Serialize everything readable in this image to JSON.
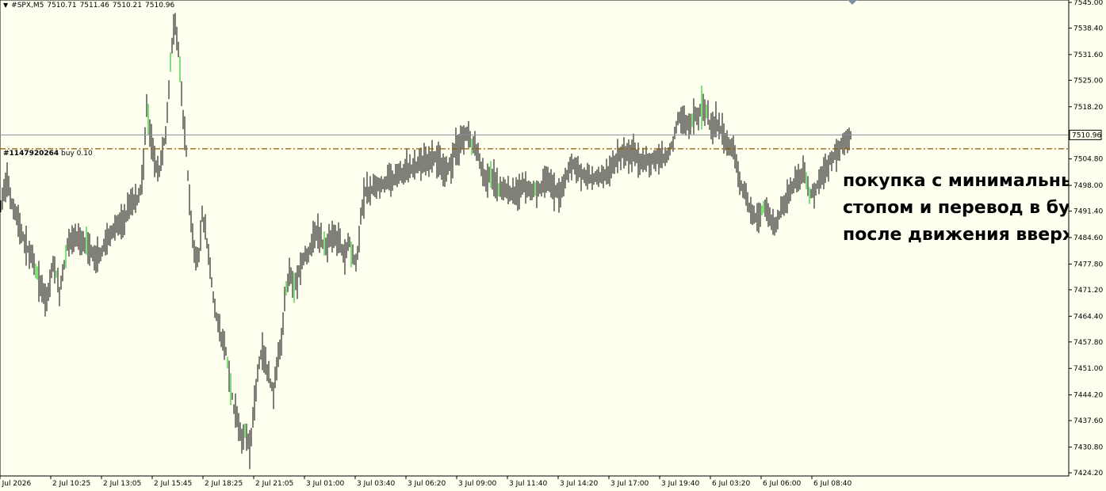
{
  "header": {
    "symbol": "#SPX,M5",
    "open": "7510.71",
    "high": "7511.46",
    "low": "7510.21",
    "close": "7510.96"
  },
  "order": {
    "id": "#1147920264",
    "side_volume": "buy 0.10",
    "price": 7507.4
  },
  "annotation": {
    "lines": [
      "покупка с минимальным",
      "стопом и перевод в бу",
      "после движения вверх"
    ]
  },
  "colors": {
    "background": "#fffff0",
    "candle": "#000000",
    "candle_up_accent": "#00c000",
    "bid_line": "#8090a0",
    "order_line": "#8b5a00"
  },
  "chart_data": {
    "type": "bar",
    "subtype": "ohlc",
    "symbol": "#SPX",
    "timeframe": "M5",
    "current_price": 7510.96,
    "current_price_label": "7510.96",
    "ylim": [
      7424.2,
      7545.0
    ],
    "y_ticks": [
      "7545.00",
      "7538.40",
      "7531.60",
      "7525.00",
      "7518.20",
      "7504.80",
      "7498.00",
      "7491.40",
      "7484.60",
      "7477.80",
      "7471.20",
      "7464.40",
      "7457.80",
      "7451.00",
      "7444.20",
      "7437.60",
      "7430.80",
      "7424.20"
    ],
    "x_ticks": [
      "2 Jul 2026",
      "2 Jul 10:25",
      "2 Jul 13:05",
      "2 Jul 15:45",
      "2 Jul 18:25",
      "2 Jul 21:05",
      "3 Jul 01:00",
      "3 Jul 03:40",
      "3 Jul 06:20",
      "3 Jul 09:00",
      "3 Jul 11:40",
      "3 Jul 14:20",
      "3 Jul 17:00",
      "3 Jul 19:40",
      "6 Jul 03:20",
      "6 Jul 06:00",
      "6 Jul 08:40"
    ],
    "price_path": [
      [
        0,
        7491
      ],
      [
        5,
        7497
      ],
      [
        10,
        7500
      ],
      [
        14,
        7494
      ],
      [
        20,
        7491
      ],
      [
        30,
        7484
      ],
      [
        40,
        7479
      ],
      [
        50,
        7473
      ],
      [
        58,
        7468
      ],
      [
        68,
        7479
      ],
      [
        75,
        7470
      ],
      [
        85,
        7483
      ],
      [
        95,
        7485
      ],
      [
        105,
        7484
      ],
      [
        115,
        7481
      ],
      [
        125,
        7480
      ],
      [
        135,
        7484
      ],
      [
        145,
        7487
      ],
      [
        155,
        7489
      ],
      [
        165,
        7493
      ],
      [
        175,
        7495
      ],
      [
        180,
        7500
      ],
      [
        185,
        7518
      ],
      [
        190,
        7510
      ],
      [
        195,
        7505
      ],
      [
        200,
        7500
      ],
      [
        205,
        7507
      ],
      [
        210,
        7512
      ],
      [
        215,
        7530
      ],
      [
        220,
        7540
      ],
      [
        225,
        7533
      ],
      [
        230,
        7518
      ],
      [
        235,
        7507
      ],
      [
        240,
        7491
      ],
      [
        245,
        7481
      ],
      [
        250,
        7478
      ],
      [
        255,
        7490
      ],
      [
        260,
        7485
      ],
      [
        265,
        7477
      ],
      [
        270,
        7468
      ],
      [
        275,
        7462
      ],
      [
        280,
        7458
      ],
      [
        285,
        7455
      ],
      [
        290,
        7448
      ],
      [
        295,
        7441
      ],
      [
        300,
        7438
      ],
      [
        305,
        7432
      ],
      [
        310,
        7435
      ],
      [
        315,
        7430
      ],
      [
        320,
        7440
      ],
      [
        325,
        7450
      ],
      [
        330,
        7456
      ],
      [
        335,
        7452
      ],
      [
        340,
        7448
      ],
      [
        345,
        7445
      ],
      [
        350,
        7452
      ],
      [
        355,
        7458
      ],
      [
        360,
        7470
      ],
      [
        365,
        7476
      ],
      [
        370,
        7473
      ],
      [
        375,
        7474
      ],
      [
        380,
        7478
      ],
      [
        385,
        7480
      ],
      [
        390,
        7481
      ],
      [
        395,
        7484
      ],
      [
        400,
        7486
      ],
      [
        405,
        7484
      ],
      [
        410,
        7482
      ],
      [
        415,
        7484
      ],
      [
        420,
        7486
      ],
      [
        425,
        7484
      ],
      [
        430,
        7482
      ],
      [
        435,
        7480
      ],
      [
        440,
        7484
      ],
      [
        445,
        7480
      ],
      [
        450,
        7478
      ],
      [
        455,
        7490
      ],
      [
        460,
        7496
      ],
      [
        470,
        7497
      ],
      [
        480,
        7498
      ],
      [
        490,
        7499
      ],
      [
        500,
        7500
      ],
      [
        510,
        7502
      ],
      [
        520,
        7502
      ],
      [
        530,
        7504
      ],
      [
        540,
        7504
      ],
      [
        550,
        7505
      ],
      [
        560,
        7502
      ],
      [
        570,
        7504
      ],
      [
        575,
        7508
      ],
      [
        580,
        7508
      ],
      [
        585,
        7510
      ],
      [
        590,
        7512
      ],
      [
        595,
        7508
      ],
      [
        600,
        7508
      ],
      [
        605,
        7504
      ],
      [
        610,
        7500
      ],
      [
        620,
        7500
      ],
      [
        630,
        7497
      ],
      [
        640,
        7496
      ],
      [
        650,
        7496
      ],
      [
        660,
        7498
      ],
      [
        670,
        7497
      ],
      [
        680,
        7497
      ],
      [
        690,
        7500
      ],
      [
        700,
        7496
      ],
      [
        710,
        7497
      ],
      [
        720,
        7504
      ],
      [
        730,
        7502
      ],
      [
        740,
        7500
      ],
      [
        750,
        7500
      ],
      [
        760,
        7500
      ],
      [
        770,
        7502
      ],
      [
        780,
        7506
      ],
      [
        790,
        7506
      ],
      [
        800,
        7506
      ],
      [
        810,
        7504
      ],
      [
        820,
        7504
      ],
      [
        830,
        7505
      ],
      [
        840,
        7505
      ],
      [
        845,
        7507
      ],
      [
        850,
        7510
      ],
      [
        855,
        7515
      ],
      [
        860,
        7515
      ],
      [
        865,
        7514
      ],
      [
        870,
        7514
      ],
      [
        875,
        7516
      ],
      [
        880,
        7516
      ],
      [
        885,
        7518
      ],
      [
        890,
        7518
      ],
      [
        895,
        7514
      ],
      [
        900,
        7514
      ],
      [
        905,
        7514
      ],
      [
        910,
        7512
      ],
      [
        915,
        7510
      ],
      [
        920,
        7508
      ],
      [
        925,
        7507
      ],
      [
        930,
        7503
      ],
      [
        935,
        7498
      ],
      [
        940,
        7496
      ],
      [
        945,
        7492
      ],
      [
        950,
        7490
      ],
      [
        955,
        7490
      ],
      [
        960,
        7492
      ],
      [
        965,
        7492
      ],
      [
        970,
        7490
      ],
      [
        975,
        7488
      ],
      [
        980,
        7488
      ],
      [
        985,
        7492
      ],
      [
        990,
        7494
      ],
      [
        995,
        7496
      ],
      [
        1000,
        7498
      ],
      [
        1005,
        7500
      ],
      [
        1010,
        7500
      ],
      [
        1015,
        7502
      ],
      [
        1020,
        7496
      ],
      [
        1025,
        7496
      ],
      [
        1030,
        7498
      ],
      [
        1035,
        7500
      ],
      [
        1040,
        7502
      ],
      [
        1045,
        7504
      ],
      [
        1050,
        7505
      ],
      [
        1055,
        7506
      ],
      [
        1060,
        7508
      ],
      [
        1065,
        7509
      ],
      [
        1070,
        7510
      ],
      [
        1073,
        7510.96
      ]
    ]
  }
}
